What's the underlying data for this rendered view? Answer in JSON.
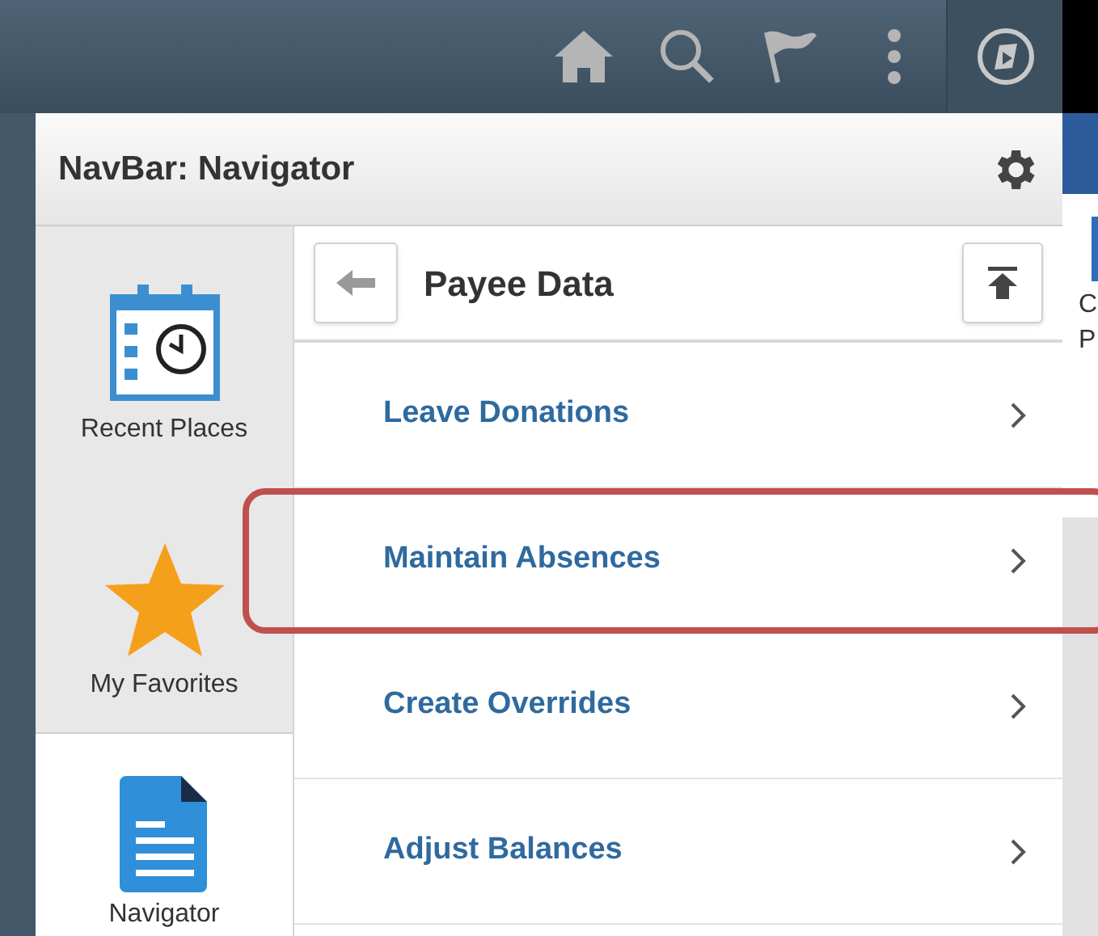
{
  "top_bar": {
    "icons": [
      {
        "kind": "home"
      },
      {
        "kind": "search"
      },
      {
        "kind": "flag"
      },
      {
        "kind": "more"
      },
      {
        "kind": "compass"
      }
    ]
  },
  "panel": {
    "title": "NavBar: Navigator"
  },
  "sidebar": {
    "items": [
      {
        "kind": "recent",
        "label": "Recent Places",
        "selected": false
      },
      {
        "kind": "favorites",
        "label": "My Favorites",
        "selected": false
      },
      {
        "kind": "navigator",
        "label": "Navigator",
        "selected": true
      }
    ]
  },
  "navigator": {
    "title": "Payee Data",
    "items": [
      {
        "label": "Leave Donations",
        "highlighted": false
      },
      {
        "label": "Maintain Absences",
        "highlighted": true
      },
      {
        "label": "Create Overrides",
        "highlighted": false
      },
      {
        "label": "Adjust Balances",
        "highlighted": false
      }
    ]
  },
  "background_page": {
    "texts": [
      "C",
      "P"
    ]
  }
}
